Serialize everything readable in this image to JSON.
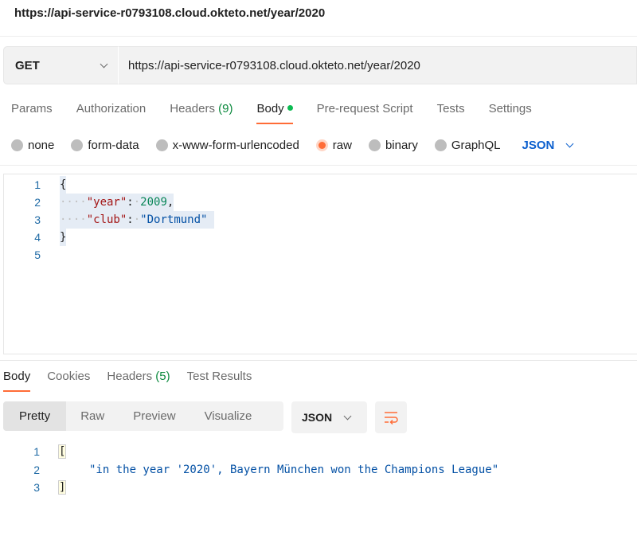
{
  "window": {
    "title": "https://api-service-r0793108.cloud.okteto.net/year/2020"
  },
  "request": {
    "method": "GET",
    "url": "https://api-service-r0793108.cloud.okteto.net/year/2020",
    "tabs": {
      "params": "Params",
      "authorization": "Authorization",
      "headers_label": "Headers",
      "headers_count": "(9)",
      "body": "Body",
      "prerequest": "Pre-request Script",
      "tests": "Tests",
      "settings": "Settings"
    },
    "body_types": {
      "none": "none",
      "form_data": "form-data",
      "urlencoded": "x-www-form-urlencoded",
      "raw": "raw",
      "binary": "binary",
      "graphql": "GraphQL",
      "selected": "raw"
    },
    "format": "JSON",
    "editor": {
      "line_numbers": [
        "1",
        "2",
        "3",
        "4",
        "5"
      ],
      "open_brace": "{",
      "close_brace": "}",
      "key_year": "\"year\"",
      "value_year": "2009",
      "key_club": "\"club\"",
      "value_club": "\"Dortmund\"",
      "colon": ":",
      "comma": ",",
      "indent_dots": "····",
      "space_dot": "·"
    }
  },
  "response": {
    "tabs": {
      "body": "Body",
      "cookies": "Cookies",
      "headers_label": "Headers",
      "headers_count": "(5)",
      "test_results": "Test Results"
    },
    "views": {
      "pretty": "Pretty",
      "raw": "Raw",
      "preview": "Preview",
      "visualize": "Visualize",
      "selected": "Pretty"
    },
    "format": "JSON",
    "editor": {
      "line_numbers": [
        "1",
        "2",
        "3"
      ],
      "open_bracket": "[",
      "close_bracket": "]",
      "message": "\"in the year '2020', Bayern München won the Champions League\""
    }
  },
  "colors": {
    "accent": "#ff6c37",
    "link_blue": "#0b5fce",
    "count_green": "#0c8a3e",
    "body_dot": "#0cbb52"
  },
  "icons": {
    "method_dropdown": "chevron-down-icon",
    "format_dropdown": "chevron-down-icon",
    "wrap": "wrap-lines-icon"
  }
}
